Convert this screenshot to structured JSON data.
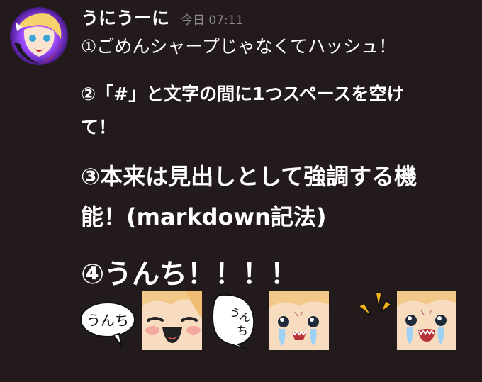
{
  "message": {
    "author": "うにうーに",
    "timestamp": "今日 07:11",
    "lines": [
      "①ごめんシャープじゃなくてハッシュ！",
      "②「#」と文字の間に1つスペースを空け",
      "て！",
      "③本来は見出しとして強調する機",
      "能！(markdown記法)",
      "④うんち！！！！"
    ]
  },
  "emojis": [
    {
      "icon": "unchi-speech-bubble-icon",
      "text": "うんち"
    },
    {
      "icon": "smiling-face-emoji-icon"
    },
    {
      "icon": "unchi-vertical-bubble-icon",
      "text_top": "うん",
      "text_bottom": "ち"
    },
    {
      "icon": "crying-face-emoji-icon"
    },
    {
      "icon": "shock-lines-icon"
    },
    {
      "icon": "crying-face-shocked-emoji-icon"
    }
  ],
  "colors": {
    "background": "#231a1b",
    "text": "#ffffff",
    "timestamp": "#8f8a8b",
    "emoji_skin": "#f8dcc0",
    "emoji_hair": "#f3c98a",
    "shock_yellow": "#f2b21b"
  }
}
